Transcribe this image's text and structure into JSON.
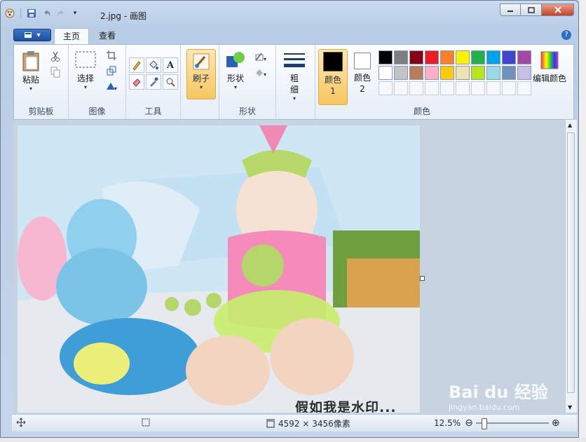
{
  "window": {
    "title": "2.jpg - 画图"
  },
  "ribbon": {
    "tabs": [
      {
        "label": "主页"
      },
      {
        "label": "查看"
      }
    ],
    "help_label": "?",
    "groups": {
      "clipboard": {
        "label": "剪贴板",
        "paste_label": "粘贴"
      },
      "image": {
        "label": "图像",
        "select_label": "选择"
      },
      "tools": {
        "label": "工具"
      },
      "brushes": {
        "label": "刷子"
      },
      "shapes": {
        "label": "形状",
        "shapes_label": "形状"
      },
      "size": {
        "label": "粗细"
      },
      "colors": {
        "label": "颜色",
        "color1_label": "颜色 1",
        "color2_label": "颜色 2",
        "edit_label": "编辑颜色",
        "color1": "#000000",
        "color2": "#ffffff",
        "palette": [
          "#000000",
          "#7f7f7f",
          "#880015",
          "#ed1c24",
          "#ff7f27",
          "#fff200",
          "#22b14c",
          "#00a2e8",
          "#3f48cc",
          "#a349a4",
          "#ffffff",
          "#c3c3c3",
          "#b97a57",
          "#ffaec9",
          "#ffc90e",
          "#efe4b0",
          "#b5e61d",
          "#99d9ea",
          "#7092be",
          "#c8bfe7"
        ]
      }
    }
  },
  "canvas": {
    "watermark_text": "假如我是水印..."
  },
  "statusbar": {
    "dimensions": "4592 × 3456像素",
    "zoom": "12.5%"
  },
  "overlay": {
    "brand": "Bai du 经验",
    "url": "jingyan.baidu.com"
  }
}
